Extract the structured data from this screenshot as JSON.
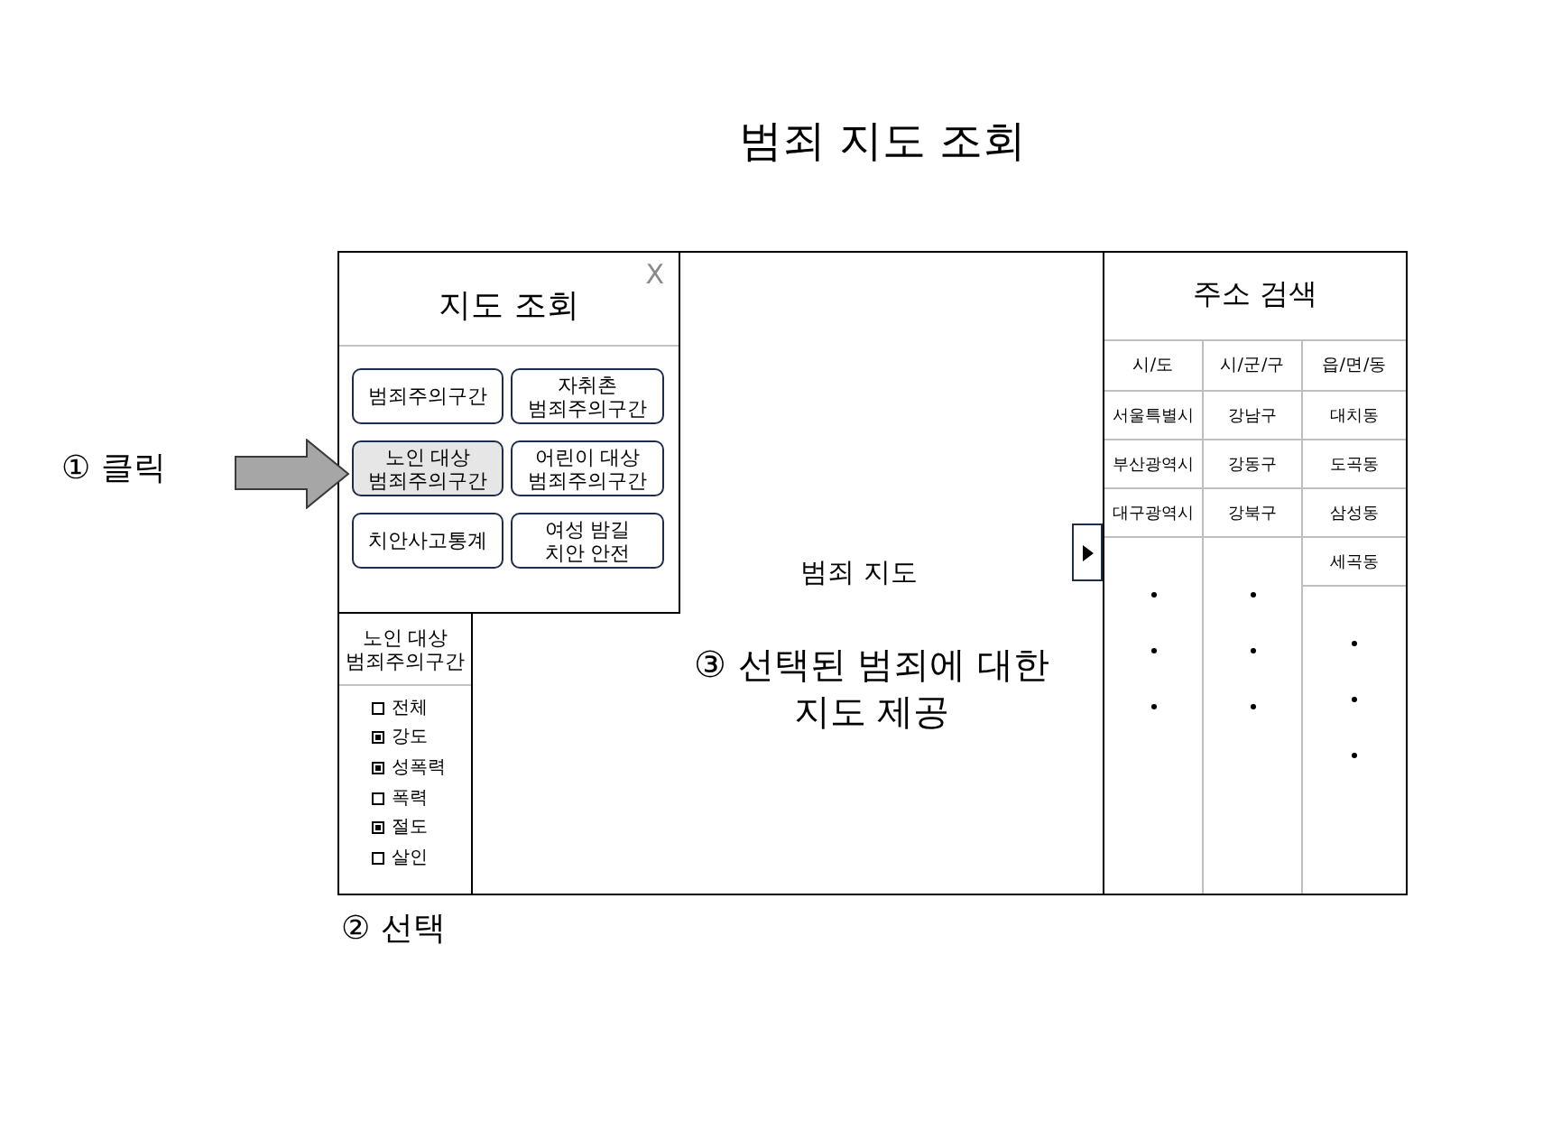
{
  "title": "범죄 지도 조회",
  "click_note": "① 클릭",
  "lookup_panel": {
    "title": "지도 조회",
    "close": "X",
    "buttons": [
      {
        "label": "범죄주의구간",
        "selected": false
      },
      {
        "label": "자취촌\n범죄주의구간",
        "selected": false
      },
      {
        "label": "노인 대상\n범죄주의구간",
        "selected": true
      },
      {
        "label": "어린이 대상\n범죄주의구간",
        "selected": false
      },
      {
        "label": "치안사고통계",
        "selected": false
      },
      {
        "label": "여성 밤길\n치안 안전",
        "selected": false
      }
    ]
  },
  "legend": {
    "title": "노인 대상\n범죄주의구간",
    "items": [
      {
        "label": "전체",
        "checked": false
      },
      {
        "label": "강도",
        "checked": true
      },
      {
        "label": "성폭력",
        "checked": true
      },
      {
        "label": "폭력",
        "checked": false
      },
      {
        "label": "절도",
        "checked": true
      },
      {
        "label": "살인",
        "checked": false
      }
    ]
  },
  "map": {
    "label": "범죄 지도"
  },
  "result_note": "③ 선택된 범죄에 대한\n지도 제공",
  "address_search": {
    "title": "주소 검색",
    "columns": [
      {
        "header": "시/도",
        "values": [
          "서울특별시",
          "부산광역시",
          "대구광역시"
        ]
      },
      {
        "header": "시/군/구",
        "values": [
          "강남구",
          "강동구",
          "강북구"
        ]
      },
      {
        "header": "읍/면/동",
        "values": [
          "대치동",
          "도곡동",
          "삼성동",
          "세곡동"
        ]
      }
    ]
  },
  "select_note": "② 선택"
}
